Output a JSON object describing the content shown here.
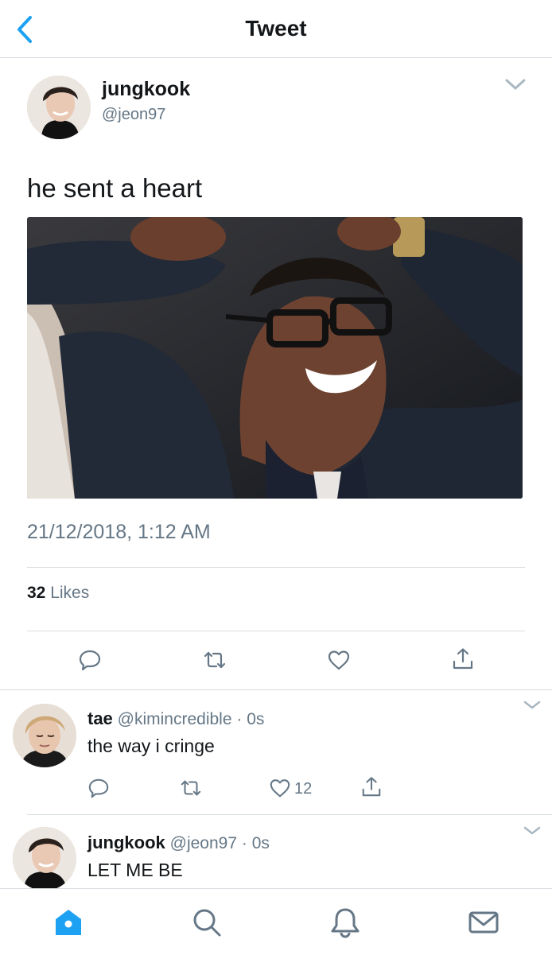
{
  "header": {
    "title": "Tweet"
  },
  "tweet": {
    "name": "jungkook",
    "handle": "@jeon97",
    "text": "he sent a heart",
    "timestamp": "21/12/2018, 1:12 AM",
    "likes_count": "32",
    "likes_label": "Likes"
  },
  "replies": [
    {
      "name": "tae",
      "handle": "@kimincredible",
      "time": "0s",
      "text": "the way i cringe",
      "like_count": "12"
    },
    {
      "name": "jungkook",
      "handle": "@jeon97",
      "time": "0s",
      "text": "LET ME BE"
    }
  ],
  "icons": {
    "back": "chevron-left-icon",
    "menu": "chevron-down-icon",
    "reply": "reply-icon",
    "retweet": "retweet-icon",
    "like": "heart-icon",
    "share": "share-icon",
    "tabs": [
      "home-icon",
      "search-icon",
      "bell-icon",
      "mail-icon"
    ]
  },
  "colors": {
    "accent": "#1da1f2",
    "secondary_text": "#657786",
    "divider": "#d8dde1"
  }
}
